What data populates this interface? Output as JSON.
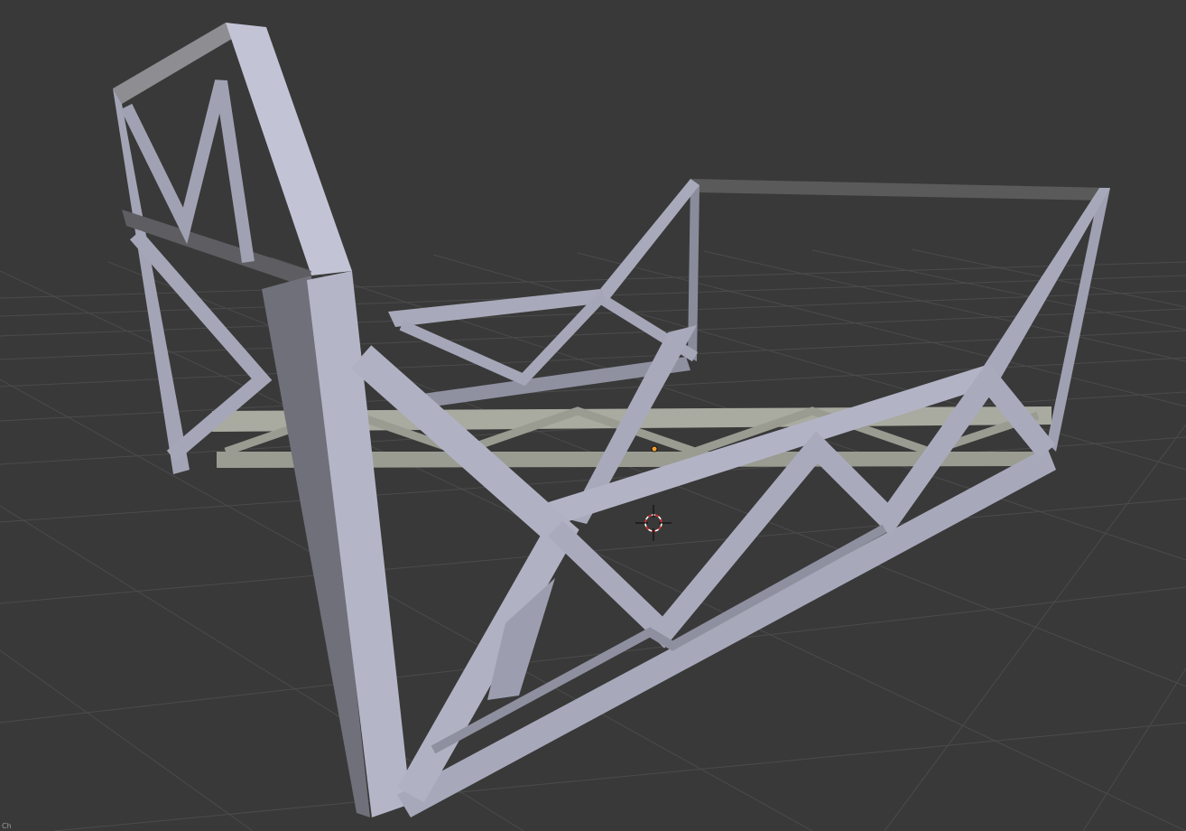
{
  "app": {
    "name": "3D viewport",
    "background_color": "#393939",
    "grid_color": "#4a4a4a",
    "model_light_color": "#b8bace",
    "model_mid_color": "#9a9cb0",
    "model_shadow_color": "#6e6f7c",
    "model_dark_color": "#5a5a62"
  },
  "viewport": {
    "corner_text": "Ch",
    "cursor_icon": "3d-cursor-icon",
    "origin_icon": "object-origin-icon",
    "origin_color": "#f0a030",
    "cursor_colors": [
      "#ff3030",
      "#ffffff"
    ]
  }
}
